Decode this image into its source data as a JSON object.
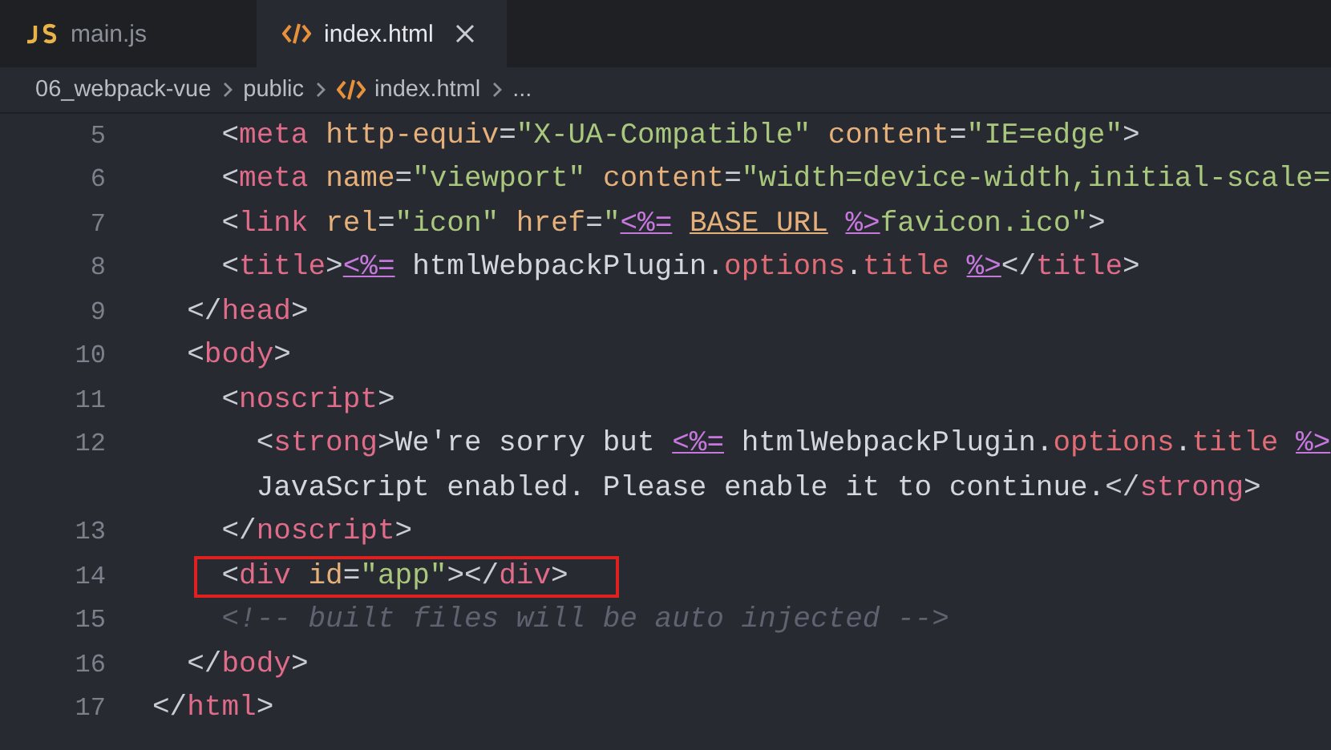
{
  "tabs": [
    {
      "label": "main.js",
      "kind": "js",
      "selected": false
    },
    {
      "label": "index.html",
      "kind": "html",
      "selected": true
    }
  ],
  "breadcrumb": [
    {
      "label": "06_webpack-vue",
      "kind": "folder"
    },
    {
      "label": "public",
      "kind": "folder"
    },
    {
      "label": "index.html",
      "kind": "html"
    },
    {
      "label": "...",
      "kind": "more"
    }
  ],
  "lines": [
    {
      "number": "5",
      "highlighted": false,
      "tokens": [
        {
          "text": "    <",
          "kind": "punct"
        },
        {
          "text": "meta",
          "kind": "tag"
        },
        {
          "text": " http-equiv",
          "kind": "attr"
        },
        {
          "text": "=",
          "kind": "punct"
        },
        {
          "text": "\"X-UA-Compatible\"",
          "kind": "string"
        },
        {
          "text": " content",
          "kind": "attr"
        },
        {
          "text": "=",
          "kind": "punct"
        },
        {
          "text": "\"IE=edge\"",
          "kind": "string"
        },
        {
          "text": ">",
          "kind": "punct"
        }
      ]
    },
    {
      "number": "6",
      "highlighted": false,
      "tokens": [
        {
          "text": "    <",
          "kind": "punct"
        },
        {
          "text": "meta",
          "kind": "tag"
        },
        {
          "text": " name",
          "kind": "attr"
        },
        {
          "text": "=",
          "kind": "punct"
        },
        {
          "text": "\"viewport\"",
          "kind": "string"
        },
        {
          "text": " content",
          "kind": "attr"
        },
        {
          "text": "=",
          "kind": "punct"
        },
        {
          "text": "\"width=device-width,initial-scale=",
          "kind": "string"
        }
      ]
    },
    {
      "number": "7",
      "highlighted": false,
      "tokens": [
        {
          "text": "    <",
          "kind": "punct"
        },
        {
          "text": "link",
          "kind": "tag"
        },
        {
          "text": " rel",
          "kind": "attr"
        },
        {
          "text": "=",
          "kind": "punct"
        },
        {
          "text": "\"icon\"",
          "kind": "string"
        },
        {
          "text": " href",
          "kind": "attr"
        },
        {
          "text": "=",
          "kind": "punct"
        },
        {
          "text": "\"",
          "kind": "string"
        },
        {
          "text": "<%=",
          "kind": "template"
        },
        {
          "text": " BASE_URL",
          "kind": "variable"
        },
        {
          "text": " %>",
          "kind": "template"
        },
        {
          "text": "favicon.ico\"",
          "kind": "string"
        },
        {
          "text": ">",
          "kind": "punct"
        }
      ]
    },
    {
      "number": "8",
      "highlighted": false,
      "tokens": [
        {
          "text": "    <",
          "kind": "punct"
        },
        {
          "text": "title",
          "kind": "tag"
        },
        {
          "text": ">",
          "kind": "punct"
        },
        {
          "text": "<%=",
          "kind": "template"
        },
        {
          "text": " htmlWebpackPlugin.",
          "kind": "text"
        },
        {
          "text": "options",
          "kind": "prop"
        },
        {
          "text": ".",
          "kind": "text"
        },
        {
          "text": "title",
          "kind": "prop"
        },
        {
          "text": " %>",
          "kind": "template"
        },
        {
          "text": "</",
          "kind": "punct"
        },
        {
          "text": "title",
          "kind": "tag"
        },
        {
          "text": ">",
          "kind": "punct"
        }
      ]
    },
    {
      "number": "9",
      "highlighted": false,
      "tokens": [
        {
          "text": "  </",
          "kind": "punct"
        },
        {
          "text": "head",
          "kind": "tag"
        },
        {
          "text": ">",
          "kind": "punct"
        }
      ]
    },
    {
      "number": "10",
      "highlighted": false,
      "tokens": [
        {
          "text": "  <",
          "kind": "punct"
        },
        {
          "text": "body",
          "kind": "tag"
        },
        {
          "text": ">",
          "kind": "punct"
        }
      ]
    },
    {
      "number": "11",
      "highlighted": false,
      "tokens": [
        {
          "text": "    <",
          "kind": "punct"
        },
        {
          "text": "noscript",
          "kind": "tag"
        },
        {
          "text": ">",
          "kind": "punct"
        }
      ]
    },
    {
      "number": "12",
      "highlighted": false,
      "tokens": [
        {
          "text": "      <",
          "kind": "punct"
        },
        {
          "text": "strong",
          "kind": "tag"
        },
        {
          "text": ">",
          "kind": "punct"
        },
        {
          "text": "We're sorry but",
          "kind": "text"
        },
        {
          "text": " <%=",
          "kind": "template"
        },
        {
          "text": " htmlWebpackPlugin.",
          "kind": "text"
        },
        {
          "text": "options",
          "kind": "prop"
        },
        {
          "text": ".",
          "kind": "text"
        },
        {
          "text": "title",
          "kind": "prop"
        },
        {
          "text": " %>",
          "kind": "template"
        }
      ]
    },
    {
      "highlighted": false,
      "tokens": [
        {
          "text": "      JavaScript enabled. Please enable it to continue.",
          "kind": "text"
        },
        {
          "text": "</",
          "kind": "punct"
        },
        {
          "text": "strong",
          "kind": "tag"
        },
        {
          "text": ">",
          "kind": "punct"
        }
      ]
    },
    {
      "number": "13",
      "highlighted": false,
      "tokens": [
        {
          "text": "    </",
          "kind": "punct"
        },
        {
          "text": "noscript",
          "kind": "tag"
        },
        {
          "text": ">",
          "kind": "punct"
        }
      ]
    },
    {
      "number": "14",
      "highlighted": true,
      "tokens": [
        {
          "text": "    <",
          "kind": "punct"
        },
        {
          "text": "div",
          "kind": "tag"
        },
        {
          "text": " id",
          "kind": "attr"
        },
        {
          "text": "=",
          "kind": "punct"
        },
        {
          "text": "\"app\"",
          "kind": "string"
        },
        {
          "text": "></",
          "kind": "punct"
        },
        {
          "text": "div",
          "kind": "tag"
        },
        {
          "text": ">",
          "kind": "punct"
        }
      ]
    },
    {
      "number": "15",
      "highlighted": false,
      "tokens": [
        {
          "text": "    <!-- built files will be auto injected -->",
          "kind": "comment"
        }
      ]
    },
    {
      "number": "16",
      "highlighted": false,
      "tokens": [
        {
          "text": "  </",
          "kind": "punct"
        },
        {
          "text": "body",
          "kind": "tag"
        },
        {
          "text": ">",
          "kind": "punct"
        }
      ]
    },
    {
      "number": "17",
      "highlighted": false,
      "tokens": [
        {
          "text": "</",
          "kind": "punct"
        },
        {
          "text": "html",
          "kind": "tag"
        },
        {
          "text": ">",
          "kind": "punct"
        }
      ]
    }
  ]
}
